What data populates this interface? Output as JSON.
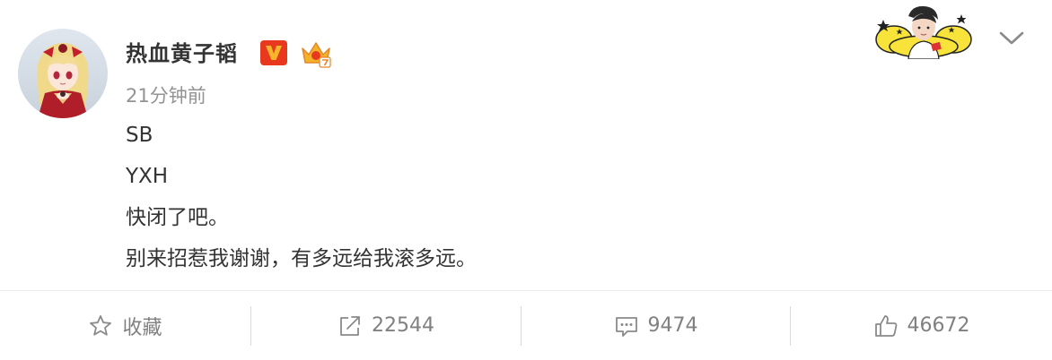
{
  "post": {
    "username": "热血黄子韬",
    "timestamp": "21分钟前",
    "content_lines": [
      "SB",
      "YXH",
      "快闭了吧。",
      "别来招惹我谢谢，有多远给我滚多远。"
    ]
  },
  "icons": {
    "verified": "verified-v-badge-icon",
    "member": "member-crown-icon",
    "decoration": "star-cloud-avatar-decoration",
    "dropdown": "chevron-down-icon",
    "favorite": "star-icon",
    "repost": "share-arrow-icon",
    "comment": "comment-bubble-icon",
    "like": "thumbs-up-icon"
  },
  "actions": {
    "favorite_label": "收藏",
    "repost_count": "22544",
    "comment_count": "9474",
    "like_count": "46672"
  },
  "colors": {
    "verified_badge": "#F4A316",
    "verified_badge_bg": "#E8391E",
    "crown": "#F2B328",
    "text_primary": "#333333",
    "text_secondary": "#939393",
    "action_text": "#808080"
  }
}
